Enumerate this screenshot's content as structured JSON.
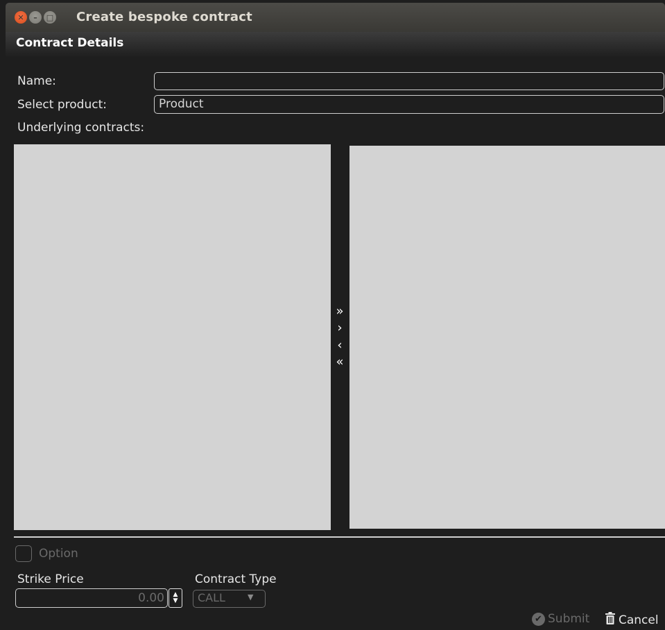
{
  "window": {
    "title": "Create bespoke contract"
  },
  "section": {
    "title": "Contract Details"
  },
  "form": {
    "name_label": "Name:",
    "name_value": "",
    "product_label": "Select product:",
    "product_value": "Product",
    "underlying_label": "Underlying contracts:"
  },
  "move_buttons": {
    "add_all": "»",
    "add": "›",
    "remove": "‹",
    "remove_all": "«"
  },
  "option": {
    "checkbox_label": "Option",
    "checked": false
  },
  "strike": {
    "label": "Strike Price",
    "value": "0.00"
  },
  "contract_type": {
    "label": "Contract Type",
    "selected": "CALL"
  },
  "actions": {
    "submit_label": "Submit",
    "cancel_label": "Cancel"
  },
  "colors": {
    "background": "#1e1e1e",
    "list_panel": "#d3d3d3",
    "close_button": "#e95420"
  }
}
